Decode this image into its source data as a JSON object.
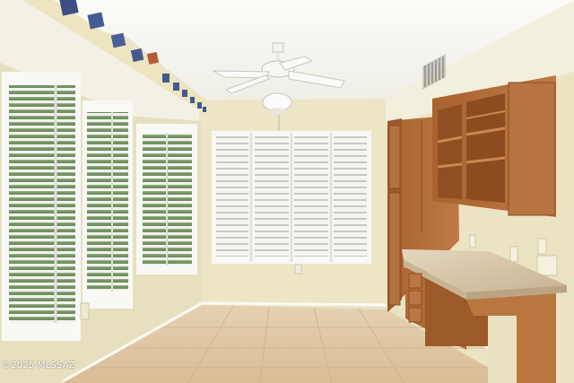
{
  "photo": {
    "kind": "interior-room-photograph",
    "watermark": "©2025 MLSSAZ"
  },
  "colors": {
    "wall": "#ece6c7",
    "ceiling": "#f7f6f1",
    "floor_tile": "#e2caa6",
    "cabinet_wood": "#b06a37",
    "counter_granite": "#d9c8ae",
    "shutter_white": "#f6f6f3"
  },
  "icons": [
    "ceiling-fan-icon",
    "air-vent-icon",
    "electrical-outlet-icon",
    "decorative-tile-icon"
  ]
}
